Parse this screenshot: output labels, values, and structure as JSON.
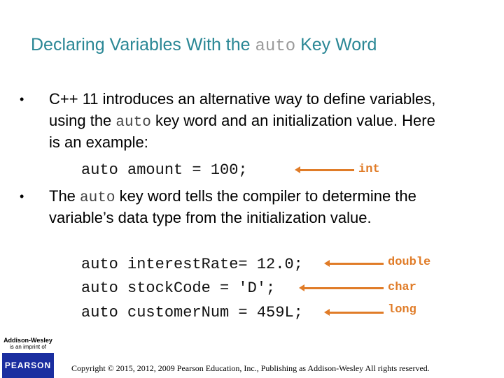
{
  "title": {
    "prefix": "Declaring Variables With the ",
    "keyword": "auto",
    "suffix": " Key Word"
  },
  "bullets": [
    {
      "line1": "C++ 11 introduces an alternative way to define variables,",
      "line2_prefix": "using the ",
      "line2_keyword": "auto",
      "line2_suffix": " key word and an initialization value. Here",
      "line3": "is an example:"
    },
    {
      "line1_prefix": "The ",
      "line1_keyword": "auto",
      "line1_suffix": " key word tells the compiler to determine the",
      "line2": "variable’s data type from the initialization value."
    }
  ],
  "example": {
    "code": "auto amount = 100;",
    "type": "int"
  },
  "examples": [
    {
      "code": "auto interestRate= 12.0;",
      "type": "double"
    },
    {
      "code": "auto stockCode = 'D';",
      "type": "char"
    },
    {
      "code": "auto customerNum = 459L;",
      "type": "long"
    }
  ],
  "logo": {
    "publisher": "Addison-Wesley",
    "imprint": "is an imprint of",
    "brand": "PEARSON"
  },
  "copyright": "Copyright © 2015, 2012, 2009 Pearson Education, Inc., Publishing as Addison-Wesley All rights reserved.",
  "colors": {
    "title": "#2a8795",
    "arrow": "#e07c28",
    "pearson": "#1a2ea0"
  }
}
